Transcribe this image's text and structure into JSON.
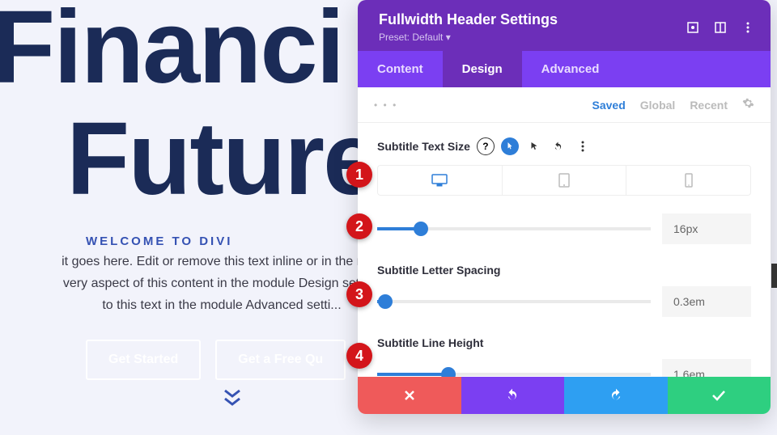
{
  "page": {
    "headline_line1": "Financi",
    "headline_line2": "Future",
    "subtitle": "Welcome to Divi",
    "body_line1": "it goes here. Edit or remove this text inline or in the mod",
    "body_line2": "very aspect of this content in the module Design setting",
    "body_line3": "to this text in the module Advanced setti...",
    "btn1": "Get Started",
    "btn2": "Get a Free Qu"
  },
  "panel": {
    "title": "Fullwidth Header Settings",
    "preset": "Preset: Default",
    "tabs": {
      "content": "Content",
      "design": "Design",
      "advanced": "Advanced"
    },
    "sublinks": {
      "saved": "Saved",
      "global": "Global",
      "recent": "Recent"
    },
    "field1_label": "Subtitle Text Size",
    "field1_value": "16px",
    "field2_label": "Subtitle Letter Spacing",
    "field2_value": "0.3em",
    "field3_label": "Subtitle Line Height",
    "field3_value": "1.6em"
  },
  "markers": {
    "m1": "1",
    "m2": "2",
    "m3": "3",
    "m4": "4"
  }
}
